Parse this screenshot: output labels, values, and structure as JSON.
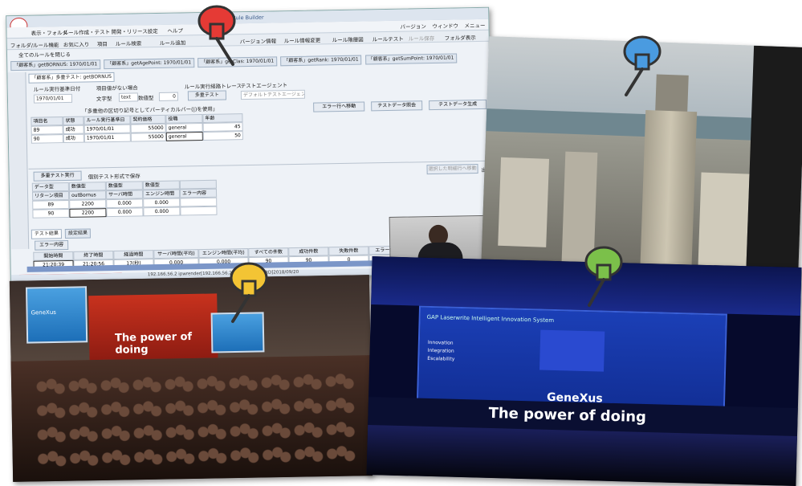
{
  "screenshot": {
    "app_title": "GeneXus Rule Builder",
    "menu": [
      "表示・フォルダ",
      "ルール作成・テスト",
      "開発・リリース設定",
      "ヘルプ"
    ],
    "menu_right": [
      "バージョン",
      "ウィンドウ",
      "メニュー"
    ],
    "toolbar": [
      "フォルダ/ルール機能",
      "お気に入り",
      "項目",
      "ルール検索",
      "ルール追加",
      "バージョン情報",
      "ルール情報変更",
      "ルール階層図",
      "ルールテスト",
      "ルール保存",
      "フォルダ表示"
    ],
    "sub_toolbar": "全てのルールを閉じる",
    "doc_tabs": [
      "「顧客系」getBORNUS: 1970/01/01",
      "「顧客系」getAgePoint: 1970/01/01",
      "「顧客系」getClas: 1970/01/01",
      "「顧客系」getRank: 1970/01/01",
      "「顧客系」getSumPoint: 1970/01/01"
    ],
    "inner_tab": "「顧客系」多重テスト: getBORNUS",
    "options": {
      "exec_date_label": "ルール実行基準日付",
      "exec_date_value": "1970/01/01",
      "no_item_label": "項目値がない場合",
      "type_label": "文字型",
      "type_value": "text",
      "numeric_label": "数値型",
      "numeric_value": "0",
      "trace_label": "ルール実行経路トレース",
      "engine_label": "テストエージェント",
      "engine_value": "デフォルトテストエージェント",
      "multi_test_button": "多重テスト"
    },
    "right_buttons": [
      "エラー行へ移動",
      "テストデータ照会",
      "テストデータ生成"
    ],
    "table_note": "「多重他の区切り記号としてパーティカルバー(|)を使用」",
    "input_headers": [
      "項目名",
      "状態",
      "ルール実行基準日付",
      "契約価格",
      "役職",
      "年齢"
    ],
    "input_rows": [
      [
        "89",
        "成功",
        "1970/01/01",
        "55000",
        "general",
        "45"
      ],
      [
        "90",
        "成功",
        "1970/01/01",
        "55000",
        "general",
        "50"
      ]
    ],
    "results_button": "多重テスト実行",
    "save_each_label": "個別テスト形式で保存",
    "result_right_buttons": [
      "選択した明細行へ移動",
      "出力"
    ],
    "result_type_labels": [
      "データ型",
      "数値型",
      "数値型",
      "数値型"
    ],
    "result_headers": [
      "リターン項目名",
      "outBornus",
      "サーバ時間",
      "エンジン時間",
      "エラー内容"
    ],
    "result_rows": [
      [
        "89",
        "2200",
        "0.000",
        "0.000",
        ""
      ],
      [
        "90",
        "2200",
        "0.000",
        "0.000",
        ""
      ]
    ],
    "bottom_tabs": [
      "テスト結果",
      "設定結果"
    ],
    "error_button": "エラー内容",
    "summary_headers": [
      "開始時間",
      "終了時間",
      "経過時間",
      "サーバ時間(平均)",
      "エンジン時間(平均)",
      "すべての件数",
      "成功件数",
      "失敗件数",
      "エラー件数"
    ],
    "summary_row": [
      "21:20:39",
      "21:20:56",
      "17(秒)",
      "0.000",
      "0.000",
      "90",
      "90",
      "0",
      "0"
    ],
    "status_bar": "192.166.56.2 ipwrender[192.166.56.2:80]  manager  [RD]2018/09/20"
  },
  "conference": {
    "slide_left": "GeneXus",
    "banner_text": "The power of doing",
    "screen_brand": "GeneXus",
    "screen_title": "GAP Laserwrite Intelligent Innovation System",
    "screen_labels": [
      "Innovation",
      "Integration",
      "Escalability"
    ],
    "stage_text": "The power of doing"
  },
  "colors": {
    "pin_red": "#e53a35",
    "pin_blue": "#4a9be0",
    "pin_yellow": "#f3c434",
    "pin_green": "#7bc04a"
  },
  "pins": [
    "red-pin-icon",
    "blue-pin-icon",
    "yellow-pin-icon",
    "green-pin-icon"
  ]
}
